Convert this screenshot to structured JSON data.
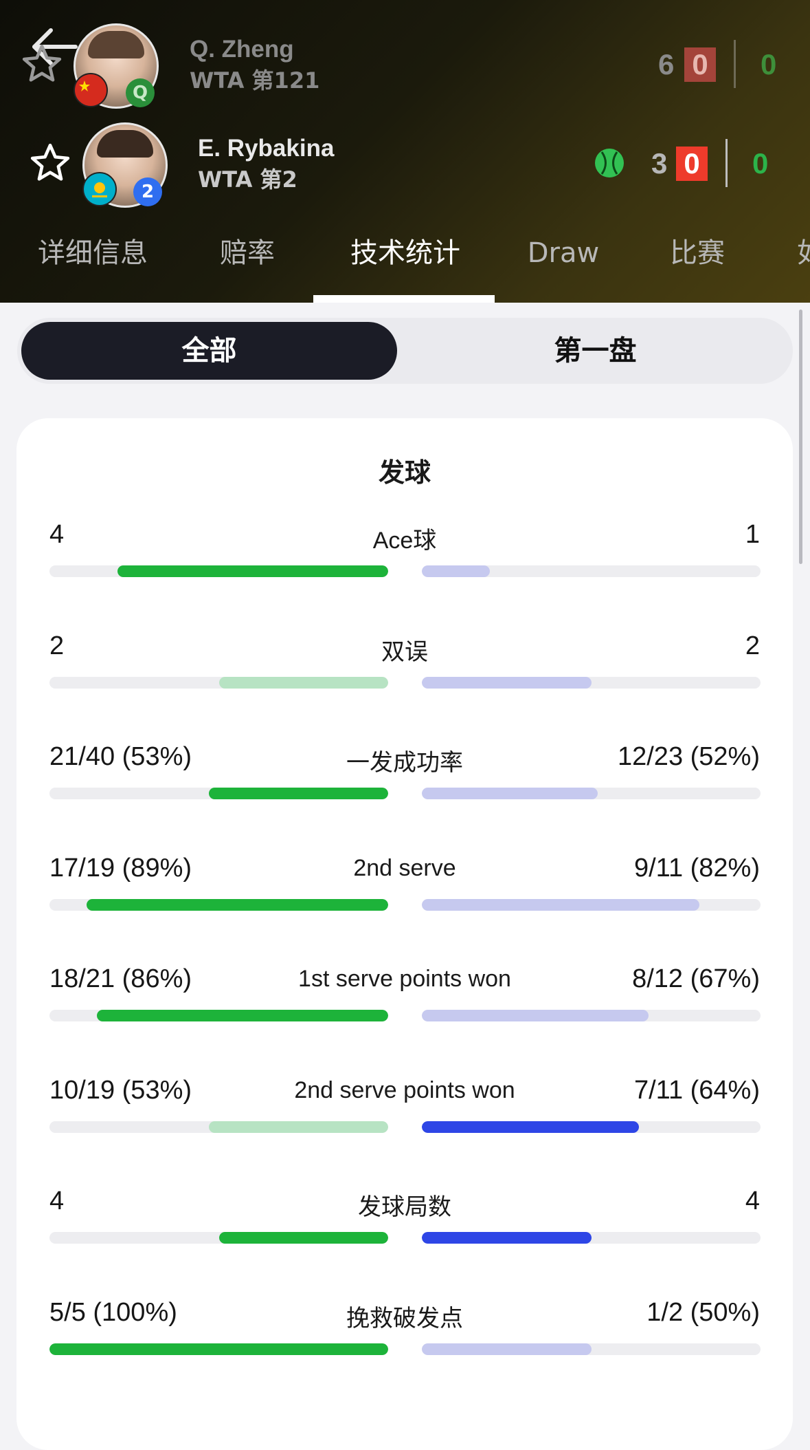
{
  "header": {
    "player1": {
      "name": "Q. Zheng",
      "rank": "WTA 第121",
      "badge": "Q",
      "score_set": "6",
      "score_game": "0",
      "score_point": "0"
    },
    "player2": {
      "name": "E. Rybakina",
      "rank": "WTA 第2",
      "badge": "2",
      "score_set": "3",
      "score_game": "0",
      "score_point": "0"
    }
  },
  "tabs": [
    {
      "label": "详细信息"
    },
    {
      "label": "赔率"
    },
    {
      "label": "技术统计"
    },
    {
      "label": "Draw"
    },
    {
      "label": "比赛"
    },
    {
      "label": "如"
    }
  ],
  "segment": {
    "all": "全部",
    "set1": "第一盘"
  },
  "section_title": "发球",
  "colors": {
    "green": "#1db33a",
    "light_green": "#b7e3c3",
    "blue": "#2e46e6",
    "light_blue": "#c6c9ef",
    "track": "#ededf0"
  },
  "stats": [
    {
      "label": "Ace球",
      "left": "4",
      "right": "1",
      "left_fill": 0.8,
      "right_fill": 0.2,
      "left_style": "green",
      "right_style": "light_blue"
    },
    {
      "label": "双误",
      "left": "2",
      "right": "2",
      "left_fill": 0.5,
      "right_fill": 0.5,
      "left_style": "light_green",
      "right_style": "light_blue"
    },
    {
      "label": "一发成功率",
      "left": "21/40 (53%)",
      "right": "12/23 (52%)",
      "left_fill": 0.53,
      "right_fill": 0.52,
      "left_style": "green",
      "right_style": "light_blue"
    },
    {
      "label": "2nd serve",
      "left": "17/19 (89%)",
      "right": "9/11 (82%)",
      "left_fill": 0.89,
      "right_fill": 0.82,
      "left_style": "green",
      "right_style": "light_blue"
    },
    {
      "label": "1st serve points won",
      "left": "18/21 (86%)",
      "right": "8/12 (67%)",
      "left_fill": 0.86,
      "right_fill": 0.67,
      "left_style": "green",
      "right_style": "light_blue"
    },
    {
      "label": "2nd serve points won",
      "left": "10/19 (53%)",
      "right": "7/11 (64%)",
      "left_fill": 0.53,
      "right_fill": 0.64,
      "left_style": "light_green",
      "right_style": "blue"
    },
    {
      "label": "发球局数",
      "left": "4",
      "right": "4",
      "left_fill": 0.5,
      "right_fill": 0.5,
      "left_style": "green",
      "right_style": "blue"
    },
    {
      "label": "挽救破发点",
      "left": "5/5 (100%)",
      "right": "1/2 (50%)",
      "left_fill": 1.0,
      "right_fill": 0.5,
      "left_style": "green",
      "right_style": "light_blue"
    }
  ]
}
